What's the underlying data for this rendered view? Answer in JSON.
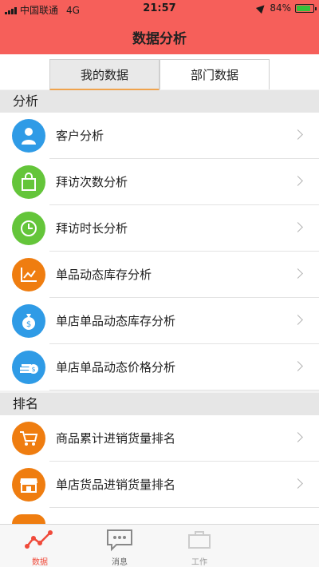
{
  "status_bar": {
    "carrier": "中国联通",
    "network": "4G",
    "time": "21:57",
    "battery_percent": "84%",
    "battery_level": 0.84
  },
  "nav": {
    "title": "数据分析"
  },
  "tabs": [
    {
      "label": "我的数据",
      "active": true
    },
    {
      "label": "部门数据",
      "active": false
    }
  ],
  "sections": [
    {
      "title": "分析",
      "items": [
        {
          "label": "客户分析",
          "icon": "person-icon",
          "color": "#2f9be6"
        },
        {
          "label": "拜访次数分析",
          "icon": "shopping-bag-icon",
          "color": "#64c53a"
        },
        {
          "label": "拜访时长分析",
          "icon": "clock-icon",
          "color": "#64c53a"
        },
        {
          "label": "单品动态库存分析",
          "icon": "line-chart-icon",
          "color": "#ef7d10"
        },
        {
          "label": "单店单品动态库存分析",
          "icon": "money-bag-icon",
          "color": "#2f9be6"
        },
        {
          "label": "单店单品动态价格分析",
          "icon": "coins-icon",
          "color": "#2f9be6"
        }
      ]
    },
    {
      "title": "排名",
      "items": [
        {
          "label": "商品累计进销货量排名",
          "icon": "cart-icon",
          "color": "#ef7d10"
        },
        {
          "label": "单店货品进销货量排名",
          "icon": "store-icon",
          "color": "#ef7d10"
        }
      ]
    }
  ],
  "tabbar": [
    {
      "label": "数据",
      "icon": "data-chart-icon",
      "active": true
    },
    {
      "label": "消息",
      "icon": "message-icon",
      "active": false
    },
    {
      "label": "工作",
      "icon": "work-icon",
      "active": false
    }
  ],
  "colors": {
    "header": "#f65f5a",
    "active_tab_underline": "#f0a34d",
    "tabbar_active": "#f04a3a"
  }
}
